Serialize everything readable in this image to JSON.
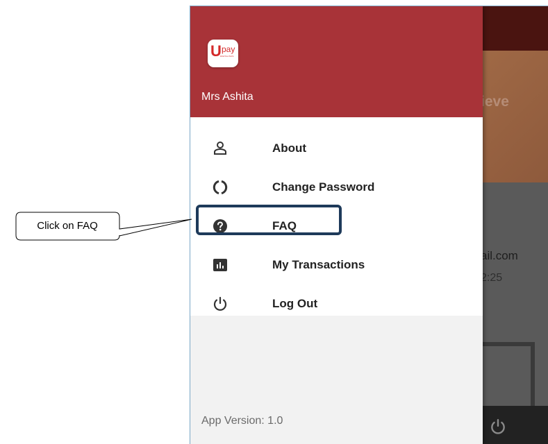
{
  "app": {
    "logo_text_u": "U",
    "logo_text_pay": "pay",
    "logo_subtext": "DIGITAL PAYA",
    "user_name": "Mrs Ashita",
    "version_label": "App Version: 1.0"
  },
  "menu": {
    "items": [
      {
        "label": "About",
        "icon": "person-icon"
      },
      {
        "label": "Change Password",
        "icon": "refresh-icon"
      },
      {
        "label": "FAQ",
        "icon": "help-circle-icon"
      },
      {
        "label": "My Transactions",
        "icon": "bar-chart-icon"
      },
      {
        "label": "Log Out",
        "icon": "power-icon"
      }
    ]
  },
  "background": {
    "banner_text": "ieve",
    "email_fragment": "ail.com",
    "time_fragment": "2:25"
  },
  "annotation": {
    "callout_text": "Click on FAQ"
  },
  "colors": {
    "header": "#a83338",
    "highlight_border": "#1e3a5a"
  }
}
